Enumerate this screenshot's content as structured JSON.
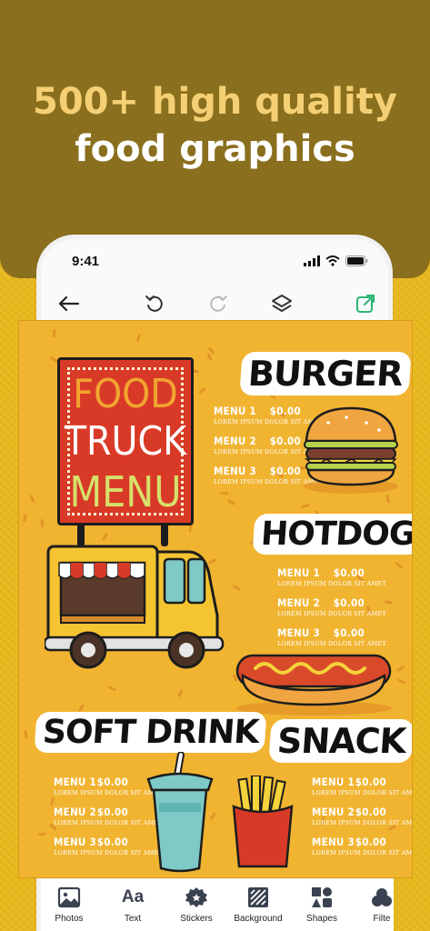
{
  "colors": {
    "header_bg": "#8a6f1e",
    "headline_accent": "#f4cf74",
    "page_bg": "#e8b81c",
    "canvas_bg": "#f1b431",
    "export_green": "#2bb673",
    "sign_red": "#d93a27"
  },
  "headline": {
    "line1": "500+ high quality",
    "line2": "food graphics"
  },
  "statusbar": {
    "time": "9:41",
    "icons": [
      "signal-icon",
      "wifi-icon",
      "battery-icon"
    ]
  },
  "toolbar": {
    "icons": [
      "back-arrow-icon",
      "undo-icon",
      "redo-icon",
      "layers-icon",
      "export-icon"
    ]
  },
  "design": {
    "sign": {
      "line1": "FOOD",
      "line2": "TRUCK",
      "line3": "MENU"
    },
    "sections": [
      {
        "title": "BURGER",
        "items": [
          {
            "name": "MENU 1",
            "price": "$0.00",
            "desc": "LOREM IPSUM DOLOR SIT AMET"
          },
          {
            "name": "MENU 2",
            "price": "$0.00",
            "desc": "LOREM IPSUM DOLOR SIT AMET"
          },
          {
            "name": "MENU 3",
            "price": "$0.00",
            "desc": "LOREM IPSUM DOLOR SIT AMET"
          }
        ]
      },
      {
        "title": "HOTDOG",
        "items": [
          {
            "name": "MENU 1",
            "price": "$0.00",
            "desc": "LOREM IPSUM DOLOR SIT AMET"
          },
          {
            "name": "MENU 2",
            "price": "$0.00",
            "desc": "LOREM IPSUM DOLOR SIT AMET"
          },
          {
            "name": "MENU 3",
            "price": "$0.00",
            "desc": "LOREM IPSUM DOLOR SIT AMET"
          }
        ]
      },
      {
        "title": "SOFT DRINK",
        "items": [
          {
            "name": "MENU 1",
            "price": "$0.00",
            "desc": "LOREM IPSUM DOLOR SIT AMET"
          },
          {
            "name": "MENU 2",
            "price": "$0.00",
            "desc": "LOREM IPSUM DOLOR SIT AMET"
          },
          {
            "name": "MENU 3",
            "price": "$0.00",
            "desc": "LOREM IPSUM DOLOR SIT AMET"
          }
        ]
      },
      {
        "title": "SNACK",
        "items": [
          {
            "name": "MENU 1",
            "price": "$0.00",
            "desc": "LOREM IPSUM DOLOR SIT AMET"
          },
          {
            "name": "MENU 2",
            "price": "$0.00",
            "desc": "LOREM IPSUM DOLOR SIT AMET"
          },
          {
            "name": "MENU 3",
            "price": "$0.00",
            "desc": "LOREM IPSUM DOLOR SIT AMET"
          }
        ]
      }
    ]
  },
  "bottom_nav": [
    {
      "label": "Photos",
      "icon": "photo-icon"
    },
    {
      "label": "Text",
      "icon": "text-icon"
    },
    {
      "label": "Stickers",
      "icon": "sticker-icon"
    },
    {
      "label": "Background",
      "icon": "background-icon"
    },
    {
      "label": "Shapes",
      "icon": "shapes-icon"
    },
    {
      "label": "Filte",
      "icon": "filter-icon"
    }
  ]
}
